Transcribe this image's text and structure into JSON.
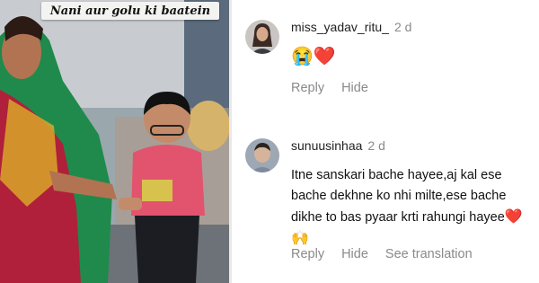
{
  "photo": {
    "caption": "Nani aur golu ki baatein"
  },
  "comments": [
    {
      "username": "miss_yadav_ritu_",
      "time": "2 d",
      "text": "",
      "emojis": "😭❤️",
      "actions": [
        "Reply",
        "Hide"
      ]
    },
    {
      "username": "sunuusinhaa",
      "time": "2 d",
      "text": "Itne sanskari bache hayee,aj kal ese bache dekhne ko nhi milte,ese bache dikhe to bas pyaar krti rahungi hayee",
      "emojis": "❤️🙌",
      "actions": [
        "Reply",
        "Hide",
        "See translation"
      ]
    }
  ]
}
